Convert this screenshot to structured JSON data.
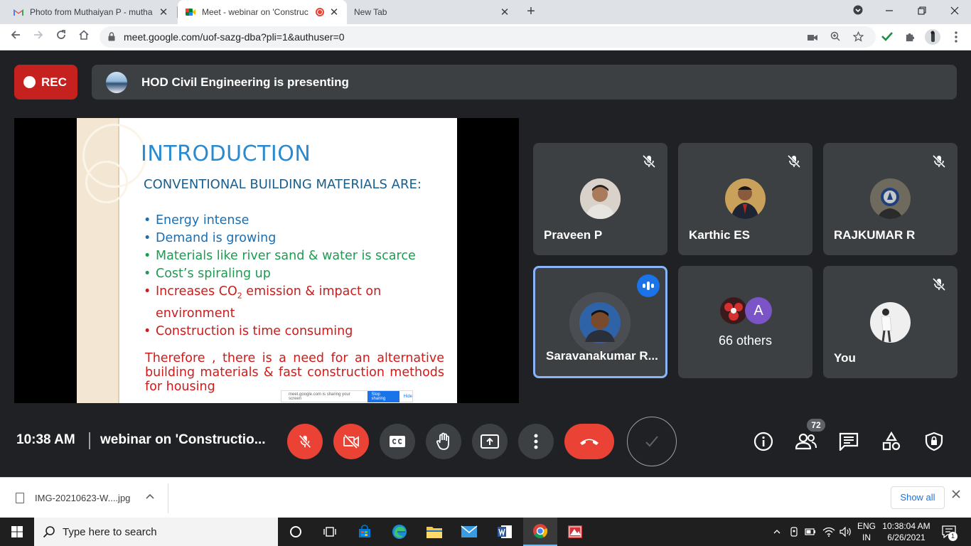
{
  "browser": {
    "tabs": [
      {
        "title": "Photo from Muthaiyan P - mutha",
        "close": "✕"
      },
      {
        "title": "Meet - webinar on 'Construc",
        "close": "✕"
      },
      {
        "title": "New Tab",
        "close": "✕"
      }
    ],
    "new_tab": "+",
    "url": "meet.google.com/uof-sazg-dba?pli=1&authuser=0"
  },
  "meet": {
    "rec_label": "REC",
    "presenting_text": "HOD Civil Engineering is presenting",
    "slide": {
      "title": "INTRODUCTION",
      "subtitle": "CONVENTIONAL BUILDING MATERIALS ARE:",
      "bullets": [
        {
          "text": "Energy intense",
          "color": "#1a6fb3"
        },
        {
          "text": "Demand is growing",
          "color": "#1a6fb3"
        },
        {
          "text": "Materials like river sand & water is scarce",
          "color": "#1d9b52"
        },
        {
          "text": "Cost’s spiraling up",
          "color": "#1d9b52"
        },
        {
          "text": "Increases CO",
          "sub": "2",
          "rest": " emission & impact on environment",
          "color": "#c91d1d"
        },
        {
          "text": "Construction is time consuming",
          "color": "#c91d1d"
        }
      ],
      "conclusion": "Therefore , there is a need for an alternative building materials & fast construction methods for housing",
      "share_bar": {
        "text": "meet.google.com is sharing your screen",
        "stop": "Stop sharing",
        "hide": "Hide"
      }
    },
    "participants": [
      {
        "name": "Praveen P",
        "muted": true
      },
      {
        "name": "Karthic ES",
        "muted": true
      },
      {
        "name": "RAJKUMAR R",
        "muted": true
      },
      {
        "name": "Saravanakumar R...",
        "speaking": true
      },
      {
        "name": "66 others",
        "avatar_letter": "A"
      },
      {
        "name": "You",
        "muted": true
      }
    ],
    "bottom": {
      "time": "10:38 AM",
      "meeting_title": "webinar on 'Constructio...",
      "participant_count": "72"
    }
  },
  "downloads": {
    "file_name": "IMG-20210623-W....jpg",
    "show_all": "Show all"
  },
  "taskbar": {
    "search_placeholder": "Type here to search",
    "lang_line1": "ENG",
    "lang_line2": "IN",
    "time": "10:38:04 AM",
    "date": "6/26/2021",
    "notification_count": "1"
  }
}
